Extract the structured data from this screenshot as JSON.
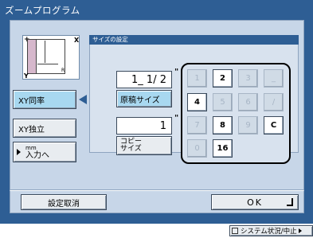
{
  "window": {
    "title": "ズームプログラム"
  },
  "preview": {
    "x_label": "X",
    "y_label": "Y",
    "r_label": "R"
  },
  "left_buttons": {
    "xy_same": "XY同率",
    "xy_independent": "XY独立",
    "mm_unit": "mm",
    "mm_input": "入力へ"
  },
  "size_settings": {
    "title": "サイズの設定",
    "original_value": "1_ 1/ 2",
    "unit_mark": "\"",
    "original_size_button": "原稿サイズ",
    "copy_value": "1",
    "copy_size_button_line1": "コピー",
    "copy_size_button_line2": "サイズ"
  },
  "keypad": {
    "keys": [
      {
        "label": "1",
        "enabled": false
      },
      {
        "label": "2",
        "enabled": true
      },
      {
        "label": "3",
        "enabled": false
      },
      {
        "label": "_",
        "enabled": false
      },
      {
        "label": "4",
        "enabled": true
      },
      {
        "label": "5",
        "enabled": false
      },
      {
        "label": "6",
        "enabled": false
      },
      {
        "label": "/",
        "enabled": false
      },
      {
        "label": "7",
        "enabled": false
      },
      {
        "label": "8",
        "enabled": true
      },
      {
        "label": "9",
        "enabled": false
      },
      {
        "label": "C",
        "enabled": true
      },
      {
        "label": "0",
        "enabled": false
      },
      {
        "label": "16",
        "enabled": true
      }
    ]
  },
  "footer": {
    "cancel_button": "設定取消",
    "ok_button": "OK"
  },
  "status_bar": {
    "system_status_button": "システム状況/中止"
  },
  "colors": {
    "frame": "#2e5e94",
    "panel": "#c7d6e8",
    "selected": "#a8d8f0"
  }
}
